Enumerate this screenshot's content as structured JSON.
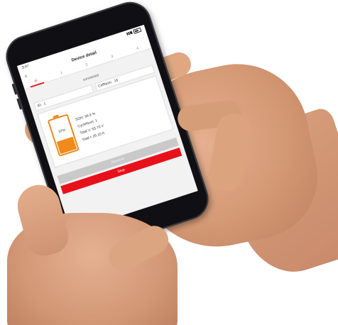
{
  "status_bar": {
    "time": "3:37"
  },
  "nav": {
    "title": "Device detail"
  },
  "tabs": [
    "P",
    "1",
    "2",
    "3",
    "4"
  ],
  "connection": {
    "status": "connected"
  },
  "fields": {
    "id_label": "ID:",
    "id_value": "1",
    "cellnum_label": "CellNum:",
    "cellnum_value": "16"
  },
  "battery": {
    "percent_label": "37%",
    "level": 0.37
  },
  "stats": {
    "soh": "SOH: 99.9 %",
    "cycle": "CycleNum: 1",
    "total_v": "Total V: 53.70 V",
    "total_i": "Total I: 25.10 A"
  },
  "buttons": {
    "disabled_label": "Reserve",
    "stop_label": "Stop"
  },
  "colors": {
    "accent_red": "#e8101a",
    "battery_orange": "#f08a1c",
    "back_blue": "#1e7fe0"
  }
}
